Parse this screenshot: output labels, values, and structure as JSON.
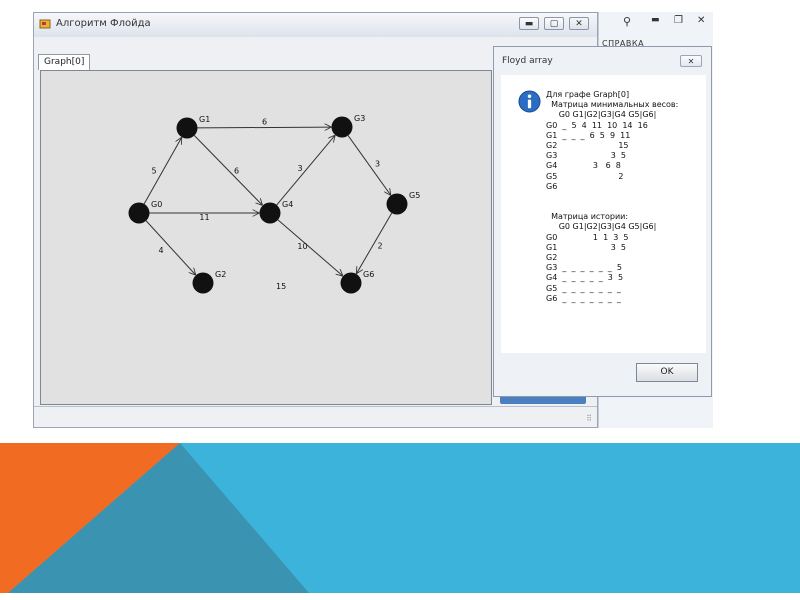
{
  "main_window": {
    "title": "Алгоритм Флойда",
    "min_glyph": "▬",
    "max_glyph": "▢",
    "close_glyph": "✕",
    "tab_label": "Graph[0]"
  },
  "graph": {
    "nodes": [
      {
        "id": "G0",
        "label": "G0"
      },
      {
        "id": "G1",
        "label": "G1"
      },
      {
        "id": "G2",
        "label": "G2"
      },
      {
        "id": "G3",
        "label": "G3"
      },
      {
        "id": "G4",
        "label": "G4"
      },
      {
        "id": "G5",
        "label": "G5"
      },
      {
        "id": "G6",
        "label": "G6"
      }
    ],
    "edges": [
      {
        "from": "G1",
        "to": "G3",
        "weight": "6"
      },
      {
        "from": "G0",
        "to": "G1",
        "weight": "5"
      },
      {
        "from": "G1",
        "to": "G4",
        "weight": "6"
      },
      {
        "from": "G0",
        "to": "G4",
        "weight": "11"
      },
      {
        "from": "G4",
        "to": "G3",
        "weight": "3"
      },
      {
        "from": "G3",
        "to": "G5",
        "weight": "3"
      },
      {
        "from": "G0",
        "to": "G2",
        "weight": "4"
      },
      {
        "from": "G4",
        "to": "G6",
        "weight": "10"
      },
      {
        "from": "G5",
        "to": "G6",
        "weight": "2"
      }
    ],
    "free_label": "15"
  },
  "sidebar": {
    "search_icon": "search-icon",
    "text": "СПРАВКА"
  },
  "dialog": {
    "title": "Floyd array",
    "close_glyph": "✕",
    "icon": "info-icon",
    "lines": [
      "Для графе Graph[0]",
      "  Матрица минимальных весов:",
      "     G0 G1|G2|G3|G4 G5|G6|",
      "G0  _  5  4  11  10  14  16",
      "G1  _  _  _  6  5  9  11",
      "G2                        15",
      "G3                     3  5",
      "G4              3   6  8",
      "G5                        2",
      "G6",
      "",
      "",
      "  Матрица истории:",
      "     G0 G1|G2|G3|G4 G5|G6|",
      "G0              1  1  3  5",
      "G1                     3  5",
      "G2",
      "G3  _  _  _  _  _  _  5",
      "G4  _  _  _  _  _  3  5",
      "G5  _  _  _  _  _  _  _",
      "G6  _  _  _  _  _  _  _"
    ],
    "ok_label": "OK"
  }
}
